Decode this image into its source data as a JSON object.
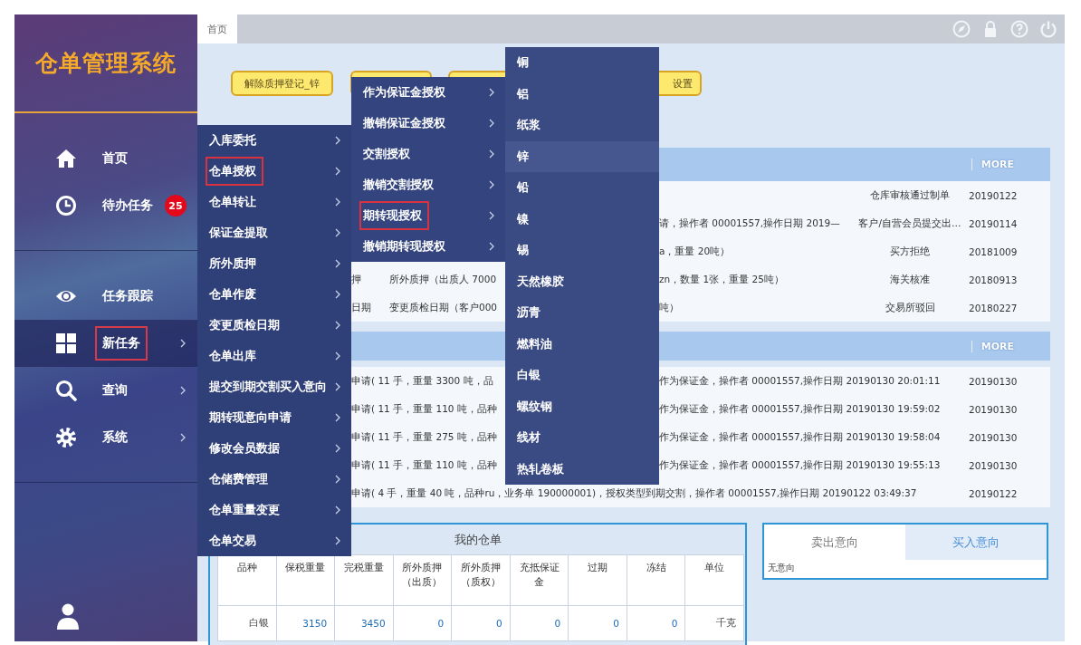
{
  "sidebar": {
    "logo": "仓单管理系统",
    "nav_groups": [
      {
        "items": [
          {
            "kind": "home",
            "label": "首页",
            "selected": false,
            "has_submenu": false
          },
          {
            "kind": "clock",
            "label": "待办任务",
            "selected": false,
            "has_submenu": false,
            "badge": "25"
          }
        ]
      },
      {
        "items": [
          {
            "kind": "eye",
            "label": "任务跟踪",
            "selected": false,
            "has_submenu": false
          },
          {
            "kind": "grid",
            "label": "新任务",
            "selected": true,
            "has_submenu": true
          },
          {
            "kind": "search",
            "label": "查询",
            "selected": false,
            "has_submenu": true
          },
          {
            "kind": "gear",
            "label": "系统",
            "selected": false,
            "has_submenu": true
          }
        ]
      }
    ]
  },
  "top_bar": {
    "tabs": [
      {
        "label": "首页",
        "selected": true
      }
    ],
    "tool_icons": [
      {
        "kind": "compass"
      },
      {
        "kind": "lock"
      },
      {
        "kind": "help"
      },
      {
        "kind": "power"
      }
    ]
  },
  "toolbar_buttons": [
    {
      "kind": "button",
      "label": "解除质押登记_锌"
    },
    {
      "kind": "button"
    },
    {
      "kind": "button"
    },
    {
      "kind": "button",
      "label": "设置"
    }
  ],
  "menus": {
    "level_1": [
      {
        "label": "入库委托",
        "selected": false
      },
      {
        "label": "仓单授权",
        "selected": true
      },
      {
        "label": "仓单转让",
        "selected": false
      },
      {
        "label": "保证金提取",
        "selected": false
      },
      {
        "label": "所外质押",
        "selected": false
      },
      {
        "label": "仓单作废",
        "selected": false
      },
      {
        "label": "变更质检日期",
        "selected": false
      },
      {
        "label": "仓单出库",
        "selected": false
      },
      {
        "label": "提交到期交割买入意向",
        "selected": false
      },
      {
        "label": "期转现意向申请",
        "selected": false
      },
      {
        "label": "修改会员数据",
        "selected": false
      },
      {
        "label": "仓储费管理",
        "selected": false
      },
      {
        "label": "仓单重量变更",
        "selected": false
      },
      {
        "label": "仓单交易",
        "selected": false
      }
    ],
    "level_2": [
      {
        "label": "作为保证金授权",
        "selected": false
      },
      {
        "label": "撤销保证金授权",
        "selected": false
      },
      {
        "label": "交割授权",
        "selected": false
      },
      {
        "label": "撤销交割授权",
        "selected": false
      },
      {
        "label": "期转现授权",
        "selected": true
      },
      {
        "label": "撤销期转现授权",
        "selected": false
      }
    ],
    "level_3": [
      {
        "label": "铜",
        "selected": false
      },
      {
        "label": "铝",
        "selected": false
      },
      {
        "label": "纸浆",
        "selected": false
      },
      {
        "label": "锌",
        "selected": true
      },
      {
        "label": "铅",
        "selected": false
      },
      {
        "label": "镍",
        "selected": false
      },
      {
        "label": "锡",
        "selected": false
      },
      {
        "label": "天然橡胶",
        "selected": false
      },
      {
        "label": "沥青",
        "selected": false
      },
      {
        "label": "燃料油",
        "selected": false
      },
      {
        "label": "白银",
        "selected": false
      },
      {
        "label": "螺纹钢",
        "selected": false
      },
      {
        "label": "线材",
        "selected": false
      },
      {
        "label": "热轧卷板",
        "selected": false
      }
    ]
  },
  "panel_1": {
    "more": "MORE",
    "rows": [
      {
        "column_4": "仓库审核通过制单",
        "column_5": "20190122"
      },
      {
        "column_3": "请，操作者 00001557,操作日期 2019—",
        "column_4": "客户/自营会员提交出…",
        "column_5": "20190114"
      },
      {
        "column_3": "a，重量 20吨）",
        "column_4": "买方拒绝",
        "column_5": "20181009"
      },
      {
        "column_1": "押",
        "column_2": "所外质押（出质人 7000",
        "column_3": "zn，数量 1张，重量 25吨）",
        "column_4": "海关核准",
        "column_5": "20180913"
      },
      {
        "column_1": "日期",
        "column_2": "变更质检日期（客户000",
        "column_3": "吨）",
        "column_4": "交易所驳回",
        "column_5": "20180227"
      }
    ]
  },
  "panel_2": {
    "more": "MORE",
    "rows": [
      {
        "column_1": "申请( 11 手，重量 3300 吨，品",
        "column_2": "作为保证金，操作者 00001557,操作日期 20190130 20:01:11",
        "column_3": "20190130"
      },
      {
        "column_1": "申请( 11 手，重量 110 吨，品种",
        "column_2": "作为保证金，操作者 00001557,操作日期 20190130 19:59:02",
        "column_3": "20190130"
      },
      {
        "column_1": "申请( 11 手，重量 275 吨，品种",
        "column_2": "作为保证金，操作者 00001557,操作日期 20190130 19:58:04",
        "column_3": "20190130"
      },
      {
        "column_1": "申请( 11 手，重量 110 吨，品种",
        "column_2": "作为保证金，操作者 00001557,操作日期 20190130 19:55:13",
        "column_3": "20190130"
      },
      {
        "column_1": "申请( 4 手，重量 40 吨，品种ru，业务单 190000001)，授权类型到期交割，操作者 00001557,操作日期 20190122 03:49:37",
        "column_3": "20190122"
      }
    ]
  },
  "my_warehouse": {
    "title": "我的仓单",
    "columns": [
      "品种",
      "保税重量",
      "完税重量",
      "所外质押（出质）",
      "所外质押（质权）",
      "充抵保证金",
      "过期",
      "冻结",
      "单位"
    ],
    "rows": [
      [
        "白银",
        "3150",
        "3450",
        "0",
        "0",
        "0",
        "0",
        "0",
        "千克"
      ]
    ]
  },
  "intent": {
    "tabs": [
      {
        "label": "卖出意向",
        "selected": true
      },
      {
        "label": "买入意向",
        "selected": false
      }
    ],
    "content": "无意向"
  }
}
